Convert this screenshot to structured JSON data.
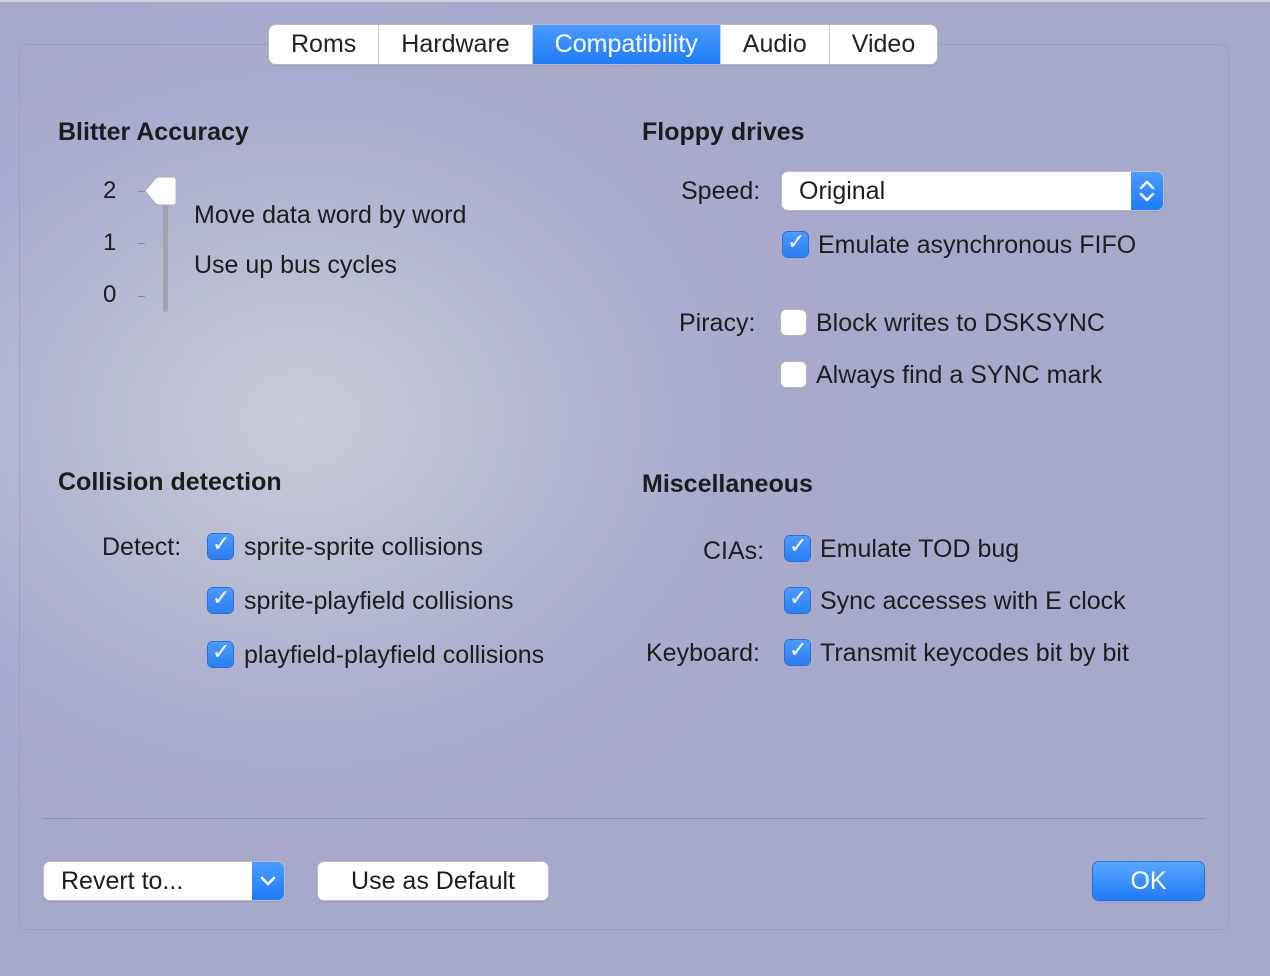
{
  "tabs": [
    "Roms",
    "Hardware",
    "Compatibility",
    "Audio",
    "Video"
  ],
  "active_tab": "Compatibility",
  "blitter": {
    "heading": "Blitter Accuracy",
    "ticks": [
      "2",
      "1",
      "0"
    ],
    "value": 2,
    "descriptions": [
      "Move data word by word",
      "Use up bus cycles"
    ]
  },
  "floppy": {
    "heading": "Floppy drives",
    "speed_label": "Speed:",
    "speed_value": "Original",
    "fifo_label": "Emulate asynchronous FIFO",
    "fifo_checked": true,
    "piracy_label": "Piracy:",
    "block_label": "Block writes to DSKSYNC",
    "block_checked": false,
    "sync_label": "Always find a SYNC mark",
    "sync_checked": false
  },
  "collision": {
    "heading": "Collision detection",
    "detect_label": "Detect:",
    "items": [
      {
        "label": "sprite-sprite collisions",
        "checked": true
      },
      {
        "label": "sprite-playfield collisions",
        "checked": true
      },
      {
        "label": "playfield-playfield collisions",
        "checked": true
      }
    ]
  },
  "misc": {
    "heading": "Miscellaneous",
    "cias_label": "CIAs:",
    "tod_label": "Emulate TOD bug",
    "tod_checked": true,
    "eclock_label": "Sync accesses with E clock",
    "eclock_checked": true,
    "keyboard_label": "Keyboard:",
    "keycodes_label": "Transmit keycodes bit by bit",
    "keycodes_checked": true
  },
  "footer": {
    "revert_label": "Revert to...",
    "default_label": "Use as Default",
    "ok_label": "OK"
  },
  "colors": {
    "accent": "#1f7cf5",
    "background": "#a9acd0"
  }
}
